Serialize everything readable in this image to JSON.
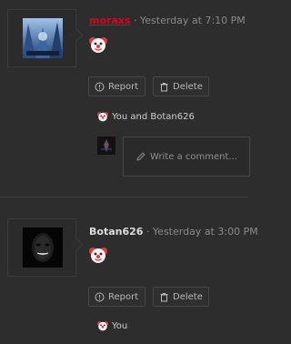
{
  "posts": [
    {
      "author": "moraxs",
      "separator": "·",
      "timestamp": "Yesterday at 7:10 PM",
      "reaction_icon": "clown-face-emoji",
      "actions": {
        "report": "Report",
        "delete": "Delete"
      },
      "likes": "You and Botan626",
      "comment_placeholder": "Write a comment..."
    },
    {
      "author": "Botan626",
      "separator": "·",
      "timestamp": "Yesterday at 3:00 PM",
      "reaction_icon": "clown-face-emoji",
      "actions": {
        "report": "Report",
        "delete": "Delete"
      },
      "likes": "You"
    }
  ],
  "colors": {
    "background": "#2d2d2d",
    "author_red": "#e0001b",
    "muted_text": "#8a8a8a",
    "border": "#474747"
  }
}
